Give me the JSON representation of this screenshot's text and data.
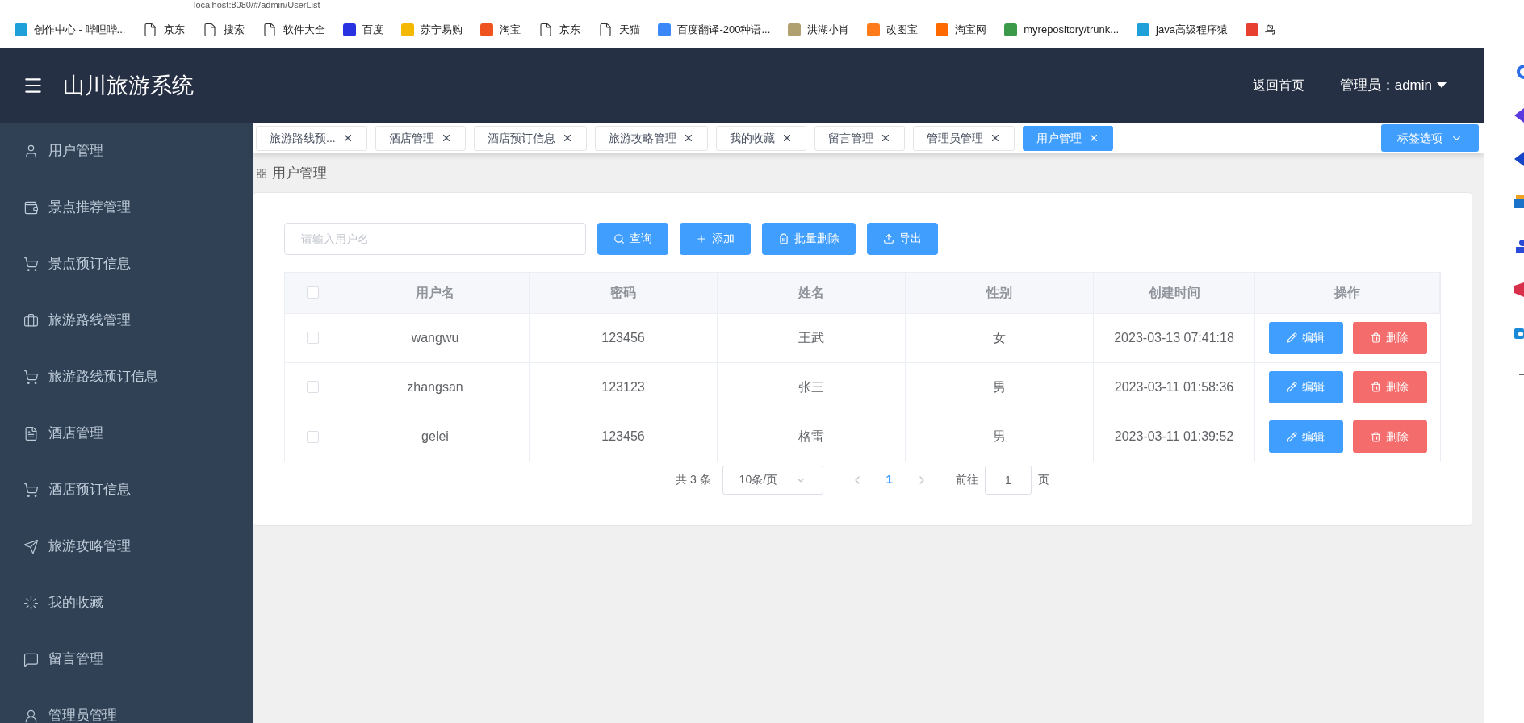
{
  "browser": {
    "address": "localhost:8080/#/admin/UserList",
    "bookmarks": [
      {
        "label": "创作中心 - 哔哩哔...",
        "kind": "site",
        "color": "#20a0d8"
      },
      {
        "label": "京东",
        "kind": "page"
      },
      {
        "label": "搜索",
        "kind": "page"
      },
      {
        "label": "软件大全",
        "kind": "page"
      },
      {
        "label": "百度",
        "kind": "site",
        "color": "#2932e1"
      },
      {
        "label": "苏宁易购",
        "kind": "site",
        "color": "#f5b800"
      },
      {
        "label": "淘宝",
        "kind": "site",
        "color": "#f0541e"
      },
      {
        "label": "京东",
        "kind": "page"
      },
      {
        "label": "天猫",
        "kind": "page"
      },
      {
        "label": "百度翻译-200种语...",
        "kind": "site",
        "color": "#3b87f7"
      },
      {
        "label": "洪湖小肖",
        "kind": "site",
        "color": "#b0a070"
      },
      {
        "label": "改图宝",
        "kind": "site",
        "color": "#ff7a1a"
      },
      {
        "label": "淘宝网",
        "kind": "site",
        "color": "#ff6a00"
      },
      {
        "label": "myrepository/trunk...",
        "kind": "site",
        "color": "#3a9a4a"
      },
      {
        "label": "java高级程序猿",
        "kind": "site",
        "color": "#20a0d8"
      },
      {
        "label": "鸟",
        "kind": "site",
        "color": "#e84030"
      }
    ]
  },
  "header": {
    "title": "山川旅游系统",
    "links": [
      "返回首页"
    ],
    "user": "管理员：admin"
  },
  "sidebar": {
    "items": [
      {
        "label": "用户管理"
      },
      {
        "label": "景点推荐管理"
      },
      {
        "label": "景点预订信息"
      },
      {
        "label": "旅游路线管理"
      },
      {
        "label": "旅游路线预订信息"
      },
      {
        "label": "酒店管理"
      },
      {
        "label": "酒店预订信息"
      },
      {
        "label": "旅游攻略管理"
      },
      {
        "label": "我的收藏"
      },
      {
        "label": "留言管理"
      },
      {
        "label": "管理员管理"
      }
    ]
  },
  "tabs": [
    {
      "label": "旅游路线预...",
      "selected": false
    },
    {
      "label": "酒店管理",
      "selected": false
    },
    {
      "label": "酒店预订信息",
      "selected": false
    },
    {
      "label": "旅游攻略管理",
      "selected": false
    },
    {
      "label": "我的收藏",
      "selected": false
    },
    {
      "label": "留言管理",
      "selected": false
    },
    {
      "label": "管理员管理",
      "selected": false
    },
    {
      "label": "用户管理",
      "selected": true
    }
  ],
  "tab_options": "标签选项",
  "breadcrumb": "用户管理",
  "search": {
    "placeholder": "请输入用户名"
  },
  "toolbar": [
    "查询",
    "添加",
    "批量删除",
    "导出"
  ],
  "table": {
    "columns": [
      "用户名",
      "密码",
      "姓名",
      "性别",
      "创建时间",
      "操作"
    ],
    "header_checked": false,
    "rows": [
      {
        "checked": false,
        "cells": [
          "wangwu",
          "123456",
          "王武",
          "女",
          "2023-03-13 07:41:18"
        ],
        "actions": [
          "编辑",
          "删除"
        ]
      },
      {
        "checked": false,
        "cells": [
          "zhangsan",
          "123123",
          "张三",
          "男",
          "2023-03-11 01:58:36"
        ],
        "actions": [
          "编辑",
          "删除"
        ]
      },
      {
        "checked": false,
        "cells": [
          "gelei",
          "123456",
          "格雷",
          "男",
          "2023-03-11 01:39:52"
        ],
        "actions": [
          "编辑",
          "删除"
        ]
      }
    ]
  },
  "pagination": {
    "total": "共 3 条",
    "page_size": "10条/页",
    "pages": [
      {
        "label": "1",
        "selected": true
      }
    ],
    "goto": "前往",
    "goto_value": "1",
    "goto_suffix": "页"
  }
}
